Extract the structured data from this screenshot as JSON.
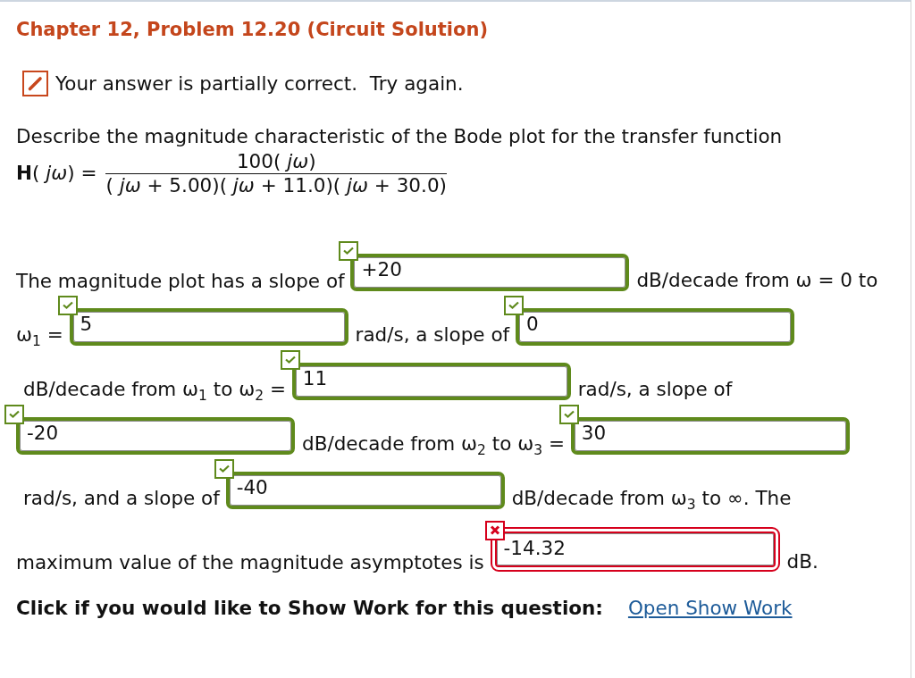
{
  "title": "Chapter 12, Problem 12.20 (Circuit Solution)",
  "feedback": "Your answer is partially correct.  Try again.",
  "question": "Describe the magnitude characteristic of the Bode plot for the transfer function",
  "transfer_function": {
    "lhs": "**H**( *jω*) =",
    "numerator": "100( *jω*)",
    "denominator": "( *jω* + 5.00)( *jω* + 11.0)( *jω* + 30.0)"
  },
  "statement": [
    {
      "kind": "text",
      "text": "The magnitude plot has a slope of"
    },
    {
      "kind": "answer",
      "value": "+20",
      "correct": true
    },
    {
      "kind": "text",
      "text": "dB/decade from ω = 0 to"
    },
    {
      "kind": "text",
      "text": "ω$_{1}$ ="
    },
    {
      "kind": "answer",
      "value": "5",
      "correct": true
    },
    {
      "kind": "text",
      "text": "rad/s, a slope of"
    },
    {
      "kind": "answer",
      "value": "0",
      "correct": true
    },
    {
      "kind": "text",
      "text": "dB/decade from ω$_{1}$ to ω$_{2}$ ="
    },
    {
      "kind": "answer",
      "value": "11",
      "correct": true
    },
    {
      "kind": "text",
      "text": "rad/s, a slope of"
    },
    {
      "kind": "answer",
      "value": "-20",
      "correct": true
    },
    {
      "kind": "text",
      "text": "dB/decade from ω$_{2}$ to ω$_{3}$ ="
    },
    {
      "kind": "answer",
      "value": "30",
      "correct": true
    },
    {
      "kind": "text",
      "text": "rad/s, and a slope of"
    },
    {
      "kind": "answer",
      "value": "-40",
      "correct": true
    },
    {
      "kind": "text",
      "text": "dB/decade from ω$_{3}$ to ∞. The"
    },
    {
      "kind": "text",
      "text": "maximum value of the magnitude asymptotes is"
    },
    {
      "kind": "answer",
      "value": "-14.32",
      "correct": false
    },
    {
      "kind": "text",
      "text": "dB."
    }
  ],
  "show_work": {
    "prompt": "Click if you would like to Show Work for this question:",
    "link": "Open Show Work"
  }
}
